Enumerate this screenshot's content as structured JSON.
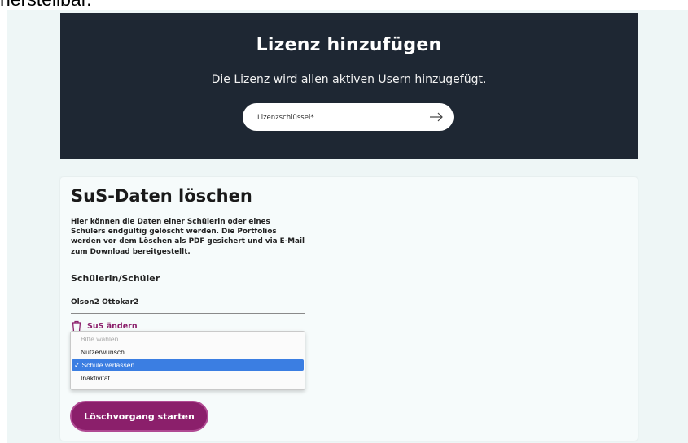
{
  "top_cutoff_text": "herstellbar.",
  "license": {
    "title": "Lizenz hinzufügen",
    "subtitle": "Die Lizenz wird allen aktiven Usern hinzugefügt.",
    "key_placeholder": "Lizenzschlüssel*",
    "submit_icon": "arrow-right-icon"
  },
  "delete_section": {
    "title": "SuS-Daten löschen",
    "description": "Hier können die Daten einer Schülerin oder eines Schülers endgültig gelöscht werden. Die Portfolios werden vor dem Löschen als PDF gesichert und via E-Mail zum Download bereitgestellt.",
    "student_label": "Schülerin/Schüler",
    "student_value": "Olson2 Ottokar2",
    "change_label": "SuS ändern",
    "change_icon": "trash-icon",
    "reason_dropdown": {
      "options": [
        "Bitte wählen…",
        "Nutzerwunsch",
        "Schule verlassen",
        "Inaktivität"
      ],
      "selected": "Schule verlassen"
    },
    "start_button": "Löschvorgang starten"
  },
  "colors": {
    "header_bg": "#1e2733",
    "accent": "#8b1f6b",
    "selection": "#3b7ee2",
    "page_bg": "#eef6f6"
  }
}
